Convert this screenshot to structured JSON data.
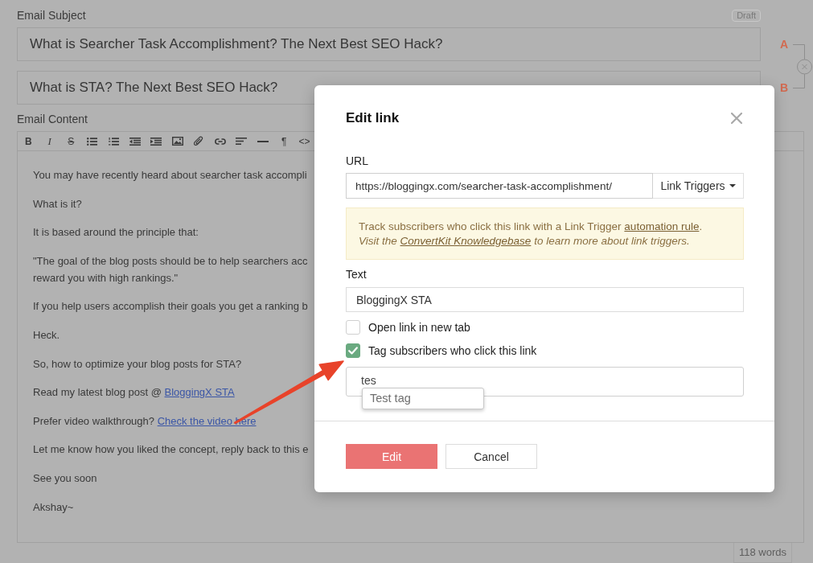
{
  "email_subject": {
    "label": "Email Subject",
    "badge": "Draft",
    "variants": [
      {
        "marker": "A",
        "value": "What is Searcher Task Accomplishment? The Next Best SEO Hack?"
      },
      {
        "marker": "B",
        "value": "What is STA? The Next Best SEO Hack?"
      }
    ]
  },
  "email_content": {
    "label": "Email Content",
    "toolbar": [
      {
        "kind": "bold",
        "label": "B"
      },
      {
        "kind": "italic",
        "label": "I"
      },
      {
        "kind": "strike",
        "label": "S"
      },
      {
        "kind": "bullets"
      },
      {
        "kind": "numbers"
      },
      {
        "kind": "outdent"
      },
      {
        "kind": "indent"
      },
      {
        "kind": "image"
      },
      {
        "kind": "attach"
      },
      {
        "kind": "link"
      },
      {
        "kind": "align"
      },
      {
        "kind": "rule"
      },
      {
        "kind": "pilcrow",
        "label": "¶"
      },
      {
        "kind": "code",
        "label": "<>"
      }
    ],
    "paragraphs": [
      {
        "lines": [
          "You may have recently heard about searcher task accompli"
        ]
      },
      {
        "lines": [
          "What is it?"
        ]
      },
      {
        "lines": [
          "It is based around the principle that:"
        ]
      },
      {
        "lines": [
          "\"The goal of the blog posts should be to help searchers acc",
          "reward you with high rankings.\""
        ]
      },
      {
        "lines": [
          "If you help users accomplish their goals you get a ranking b"
        ]
      },
      {
        "lines": [
          "Heck."
        ]
      },
      {
        "lines": [
          "So, how to optimize your blog posts for STA?"
        ]
      },
      {
        "lines": [
          "Read my latest blog post @ "
        ],
        "link": "BloggingX STA"
      },
      {
        "lines": [
          "Prefer video walkthrough? "
        ],
        "link": "Check the video here"
      },
      {
        "lines": [
          "Let me know how you liked the concept, reply back to this e"
        ]
      },
      {
        "lines": [
          "See you soon"
        ]
      },
      {
        "lines": [
          "Akshay~"
        ]
      }
    ],
    "word_count": "118 words"
  },
  "edit_link_dialog": {
    "title": "Edit link",
    "url": {
      "label": "URL",
      "value": "https://bloggingx.com/searcher-task-accomplishment/",
      "trigger_button": "Link Triggers"
    },
    "notice": [
      {
        "kind": "main",
        "before": "Track subscribers who click this link with a Link Trigger ",
        "link": "automation rule",
        "after": "."
      },
      {
        "kind": "tip",
        "before": "Visit the ",
        "link": "ConvertKit Knowledgebase",
        "after": " to learn more about link triggers."
      }
    ],
    "text": {
      "label": "Text",
      "value": "BloggingX STA"
    },
    "options": [
      {
        "label": "Open link in new tab",
        "checked": false
      },
      {
        "label": "Tag subscribers who click this link",
        "checked": true
      }
    ],
    "tag_field": {
      "value": "tes",
      "suggestions": [
        "Test tag"
      ]
    },
    "buttons": [
      {
        "kind": "primary",
        "label": "Edit"
      },
      {
        "kind": "secondary",
        "label": "Cancel"
      }
    ]
  }
}
